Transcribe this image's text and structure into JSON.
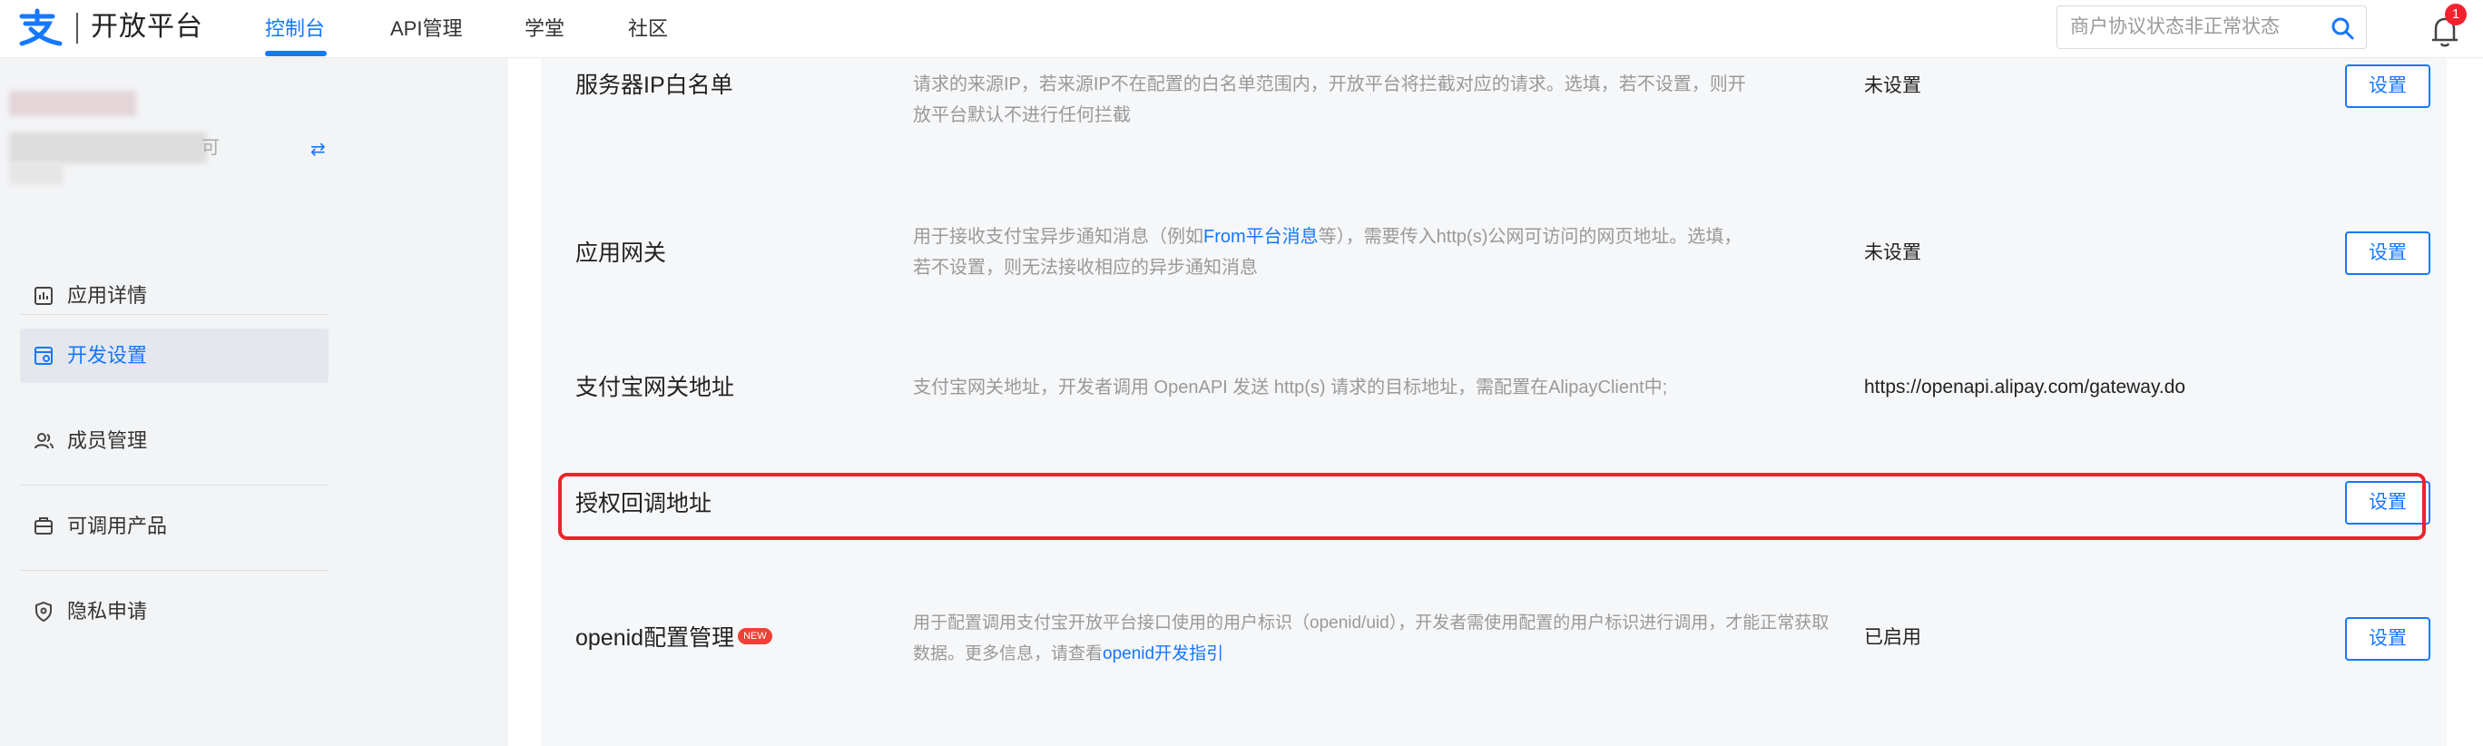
{
  "header": {
    "logo_text": "开放平台",
    "nav": [
      {
        "label": "控制台",
        "active": true
      },
      {
        "label": "API管理",
        "active": false
      },
      {
        "label": "学堂",
        "active": false
      },
      {
        "label": "社区",
        "active": false
      }
    ],
    "search_placeholder": "商户协议状态非正常状态",
    "notification_count": "1"
  },
  "sidebar": {
    "app_name_suffix": "可",
    "switch_icon": "⇄",
    "items": [
      {
        "label": "应用详情",
        "icon": "chart-icon",
        "active": false
      },
      {
        "label": "开发设置",
        "icon": "dev-settings-icon",
        "active": true
      },
      {
        "label": "成员管理",
        "icon": "members-icon",
        "active": false
      },
      {
        "label": "可调用产品",
        "icon": "products-icon",
        "active": false
      },
      {
        "label": "隐私申请",
        "icon": "privacy-icon",
        "active": false
      }
    ]
  },
  "settings": [
    {
      "title": "服务器IP白名单",
      "desc_line1": "请求的来源IP，若来源IP不在配置的白名单范围内，开放平台将拦截对应的请求。选填，若不设置，则开",
      "desc_line2": "放平台默认不进行任何拦截",
      "value": "未设置",
      "button": "设置"
    },
    {
      "title": "应用网关",
      "desc_line1_pre": "用于接收支付宝异步通知消息（例如",
      "desc_line1_link": "From平台消息",
      "desc_line1_post": "等），需要传入http(s)公网可访问的网页地址。选填，",
      "desc_line2": "若不设置，则无法接收相应的异步通知消息",
      "value": "未设置",
      "button": "设置"
    },
    {
      "title": "支付宝网关地址",
      "desc_line1": "支付宝网关地址，开发者调用 OpenAPI 发送 http(s) 请求的目标地址，需配置在AlipayClient中;",
      "value": "https://openapi.alipay.com/gateway.do"
    },
    {
      "title": "授权回调地址",
      "button": "设置"
    },
    {
      "title": "openid配置管理",
      "badge": "NEW",
      "desc_line1": "用于配置调用支付宝开放平台接口使用的用户标识（openid/uid），开发者需使用配置的用户标识进行调用，才能正常获取",
      "desc_line2_pre": "数据。更多信息，请查看",
      "desc_line2_link": "openid开发指引",
      "value": "已启用",
      "button": "设置"
    }
  ],
  "colors": {
    "accent": "#1677ff",
    "highlight": "#e8262c",
    "badge": "#f04134"
  }
}
